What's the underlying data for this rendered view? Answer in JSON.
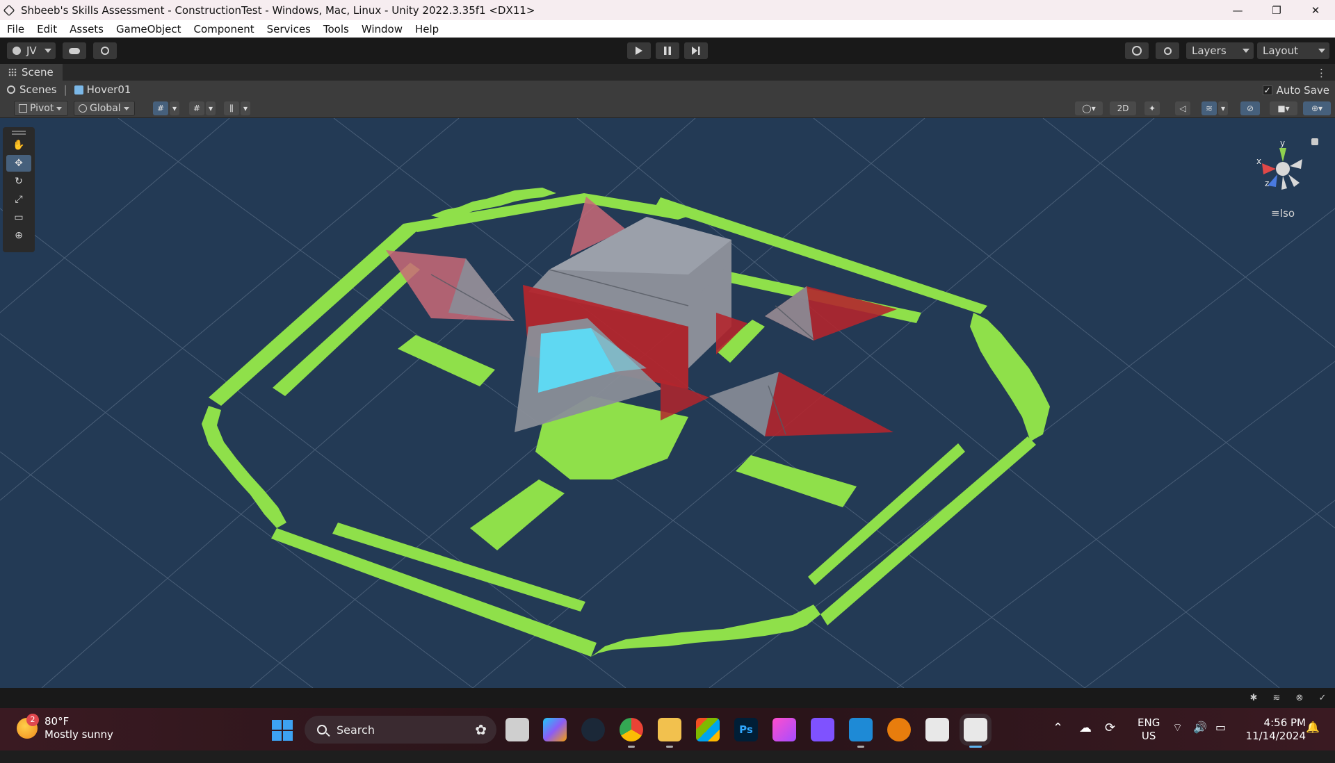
{
  "window": {
    "title": "Shbeeb's Skills Assessment - ConstructionTest - Windows, Mac, Linux - Unity 2022.3.35f1 <DX11>",
    "minimize": "—",
    "maximize": "❐",
    "close": "✕"
  },
  "menu": {
    "items": [
      "File",
      "Edit",
      "Assets",
      "GameObject",
      "Component",
      "Services",
      "Tools",
      "Window",
      "Help"
    ]
  },
  "toolbar": {
    "account_label": "JV",
    "layers_label": "Layers",
    "layout_label": "Layout",
    "play_icon": "play-icon",
    "pause_icon": "pause-icon",
    "step_icon": "step-icon"
  },
  "scene": {
    "tab_label": "Scene",
    "breadcrumb_root": "Scenes",
    "breadcrumb_prefab": "Hover01",
    "auto_save_label": "Auto Save",
    "auto_save_checked": true,
    "pivot_label": "Pivot",
    "global_label": "Global",
    "mode_2d_label": "2D",
    "projection_label": "Iso",
    "gizmo_axes": {
      "x": "x",
      "y": "y",
      "z": "z"
    }
  },
  "colors": {
    "viewport_bg": "#233a55",
    "pad_green": "#8fe04a",
    "body_grey": "#8a8e98",
    "red_panel": "#b3262d",
    "cyan_glass": "#5fd8f2",
    "selected_tool": "#46607c"
  },
  "taskbar": {
    "weather_badge": "2",
    "weather_temp": "80°F",
    "weather_desc": "Mostly sunny",
    "search_label": "Search",
    "lang_line1": "ENG",
    "lang_line2": "US",
    "time": "4:56 PM",
    "date": "11/14/2024",
    "photoshop_label": "Ps"
  }
}
